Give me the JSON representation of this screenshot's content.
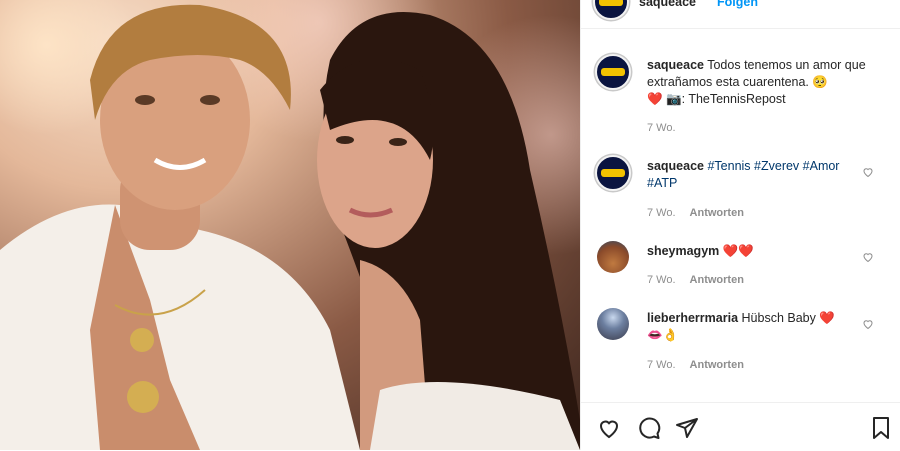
{
  "post": {
    "username": "saqueace",
    "follow_label": "Folgen"
  },
  "caption": {
    "username": "saqueace",
    "text": "Todos tenemos un amor que extrañamos esta cuarentena. 🥺",
    "text2": "❤️ 📷: TheTennisRepost",
    "time": "7 Wo."
  },
  "comments": [
    {
      "username": "saqueace",
      "text": "#Tennis #Zverev #Amor #ATP",
      "time": "7 Wo.",
      "reply": "Antworten"
    },
    {
      "username": "sheymagym",
      "text": "❤️❤️",
      "time": "7 Wo.",
      "reply": "Antworten"
    },
    {
      "username": "lieberherrmaria",
      "text": "Hübsch Baby ❤️",
      "text2": "👄👌",
      "time": "7 Wo.",
      "reply": "Antworten"
    }
  ],
  "icons": [
    "heart-icon",
    "comment-icon",
    "share-icon",
    "bookmark-icon",
    "more-icon"
  ],
  "colors": {
    "link": "#00376b",
    "follow": "#0095f6",
    "muted": "#8e8e8e",
    "heart": "#ed4956"
  }
}
